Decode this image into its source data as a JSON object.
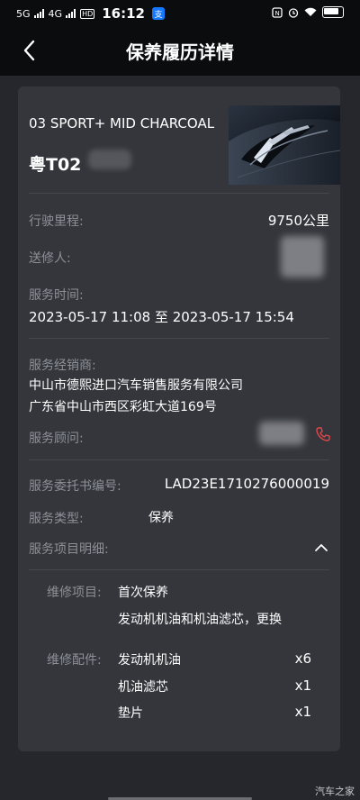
{
  "status_bar": {
    "signal1": "5G",
    "signal2": "4G",
    "hd": "HD",
    "time": "16:12",
    "pay_icon": "支"
  },
  "header": {
    "title": "保养履历详情"
  },
  "vehicle": {
    "name": "03 SPORT+ MID CHARCOAL",
    "plate_visible": "粤T02"
  },
  "mileage": {
    "label": "行驶里程:",
    "value": "9750公里"
  },
  "sender": {
    "label": "送修人:"
  },
  "service_time": {
    "label": "服务时间:",
    "value": "2023-05-17 11:08 至 2023-05-17 15:54"
  },
  "dealer": {
    "label": "服务经销商:",
    "name": "中山市德熙进口汽车销售服务有限公司",
    "address": "广东省中山市西区彩虹大道169号"
  },
  "advisor": {
    "label": "服务顾问:"
  },
  "order": {
    "label": "服务委托书编号:",
    "value": "LAD23E1710276000019"
  },
  "service_type": {
    "label": "服务类型:",
    "value": "保养"
  },
  "details": {
    "label": "服务项目明细:",
    "repair_label": "维修项目:",
    "repair_items": [
      "首次保养",
      "发动机机油和机油滤芯，更换"
    ],
    "parts_label": "维修配件:",
    "parts": [
      {
        "name": "发动机机油",
        "qty": "x6"
      },
      {
        "name": "机油滤芯",
        "qty": "x1"
      },
      {
        "name": "垫片",
        "qty": "x1"
      }
    ]
  },
  "watermark": "汽车之家"
}
